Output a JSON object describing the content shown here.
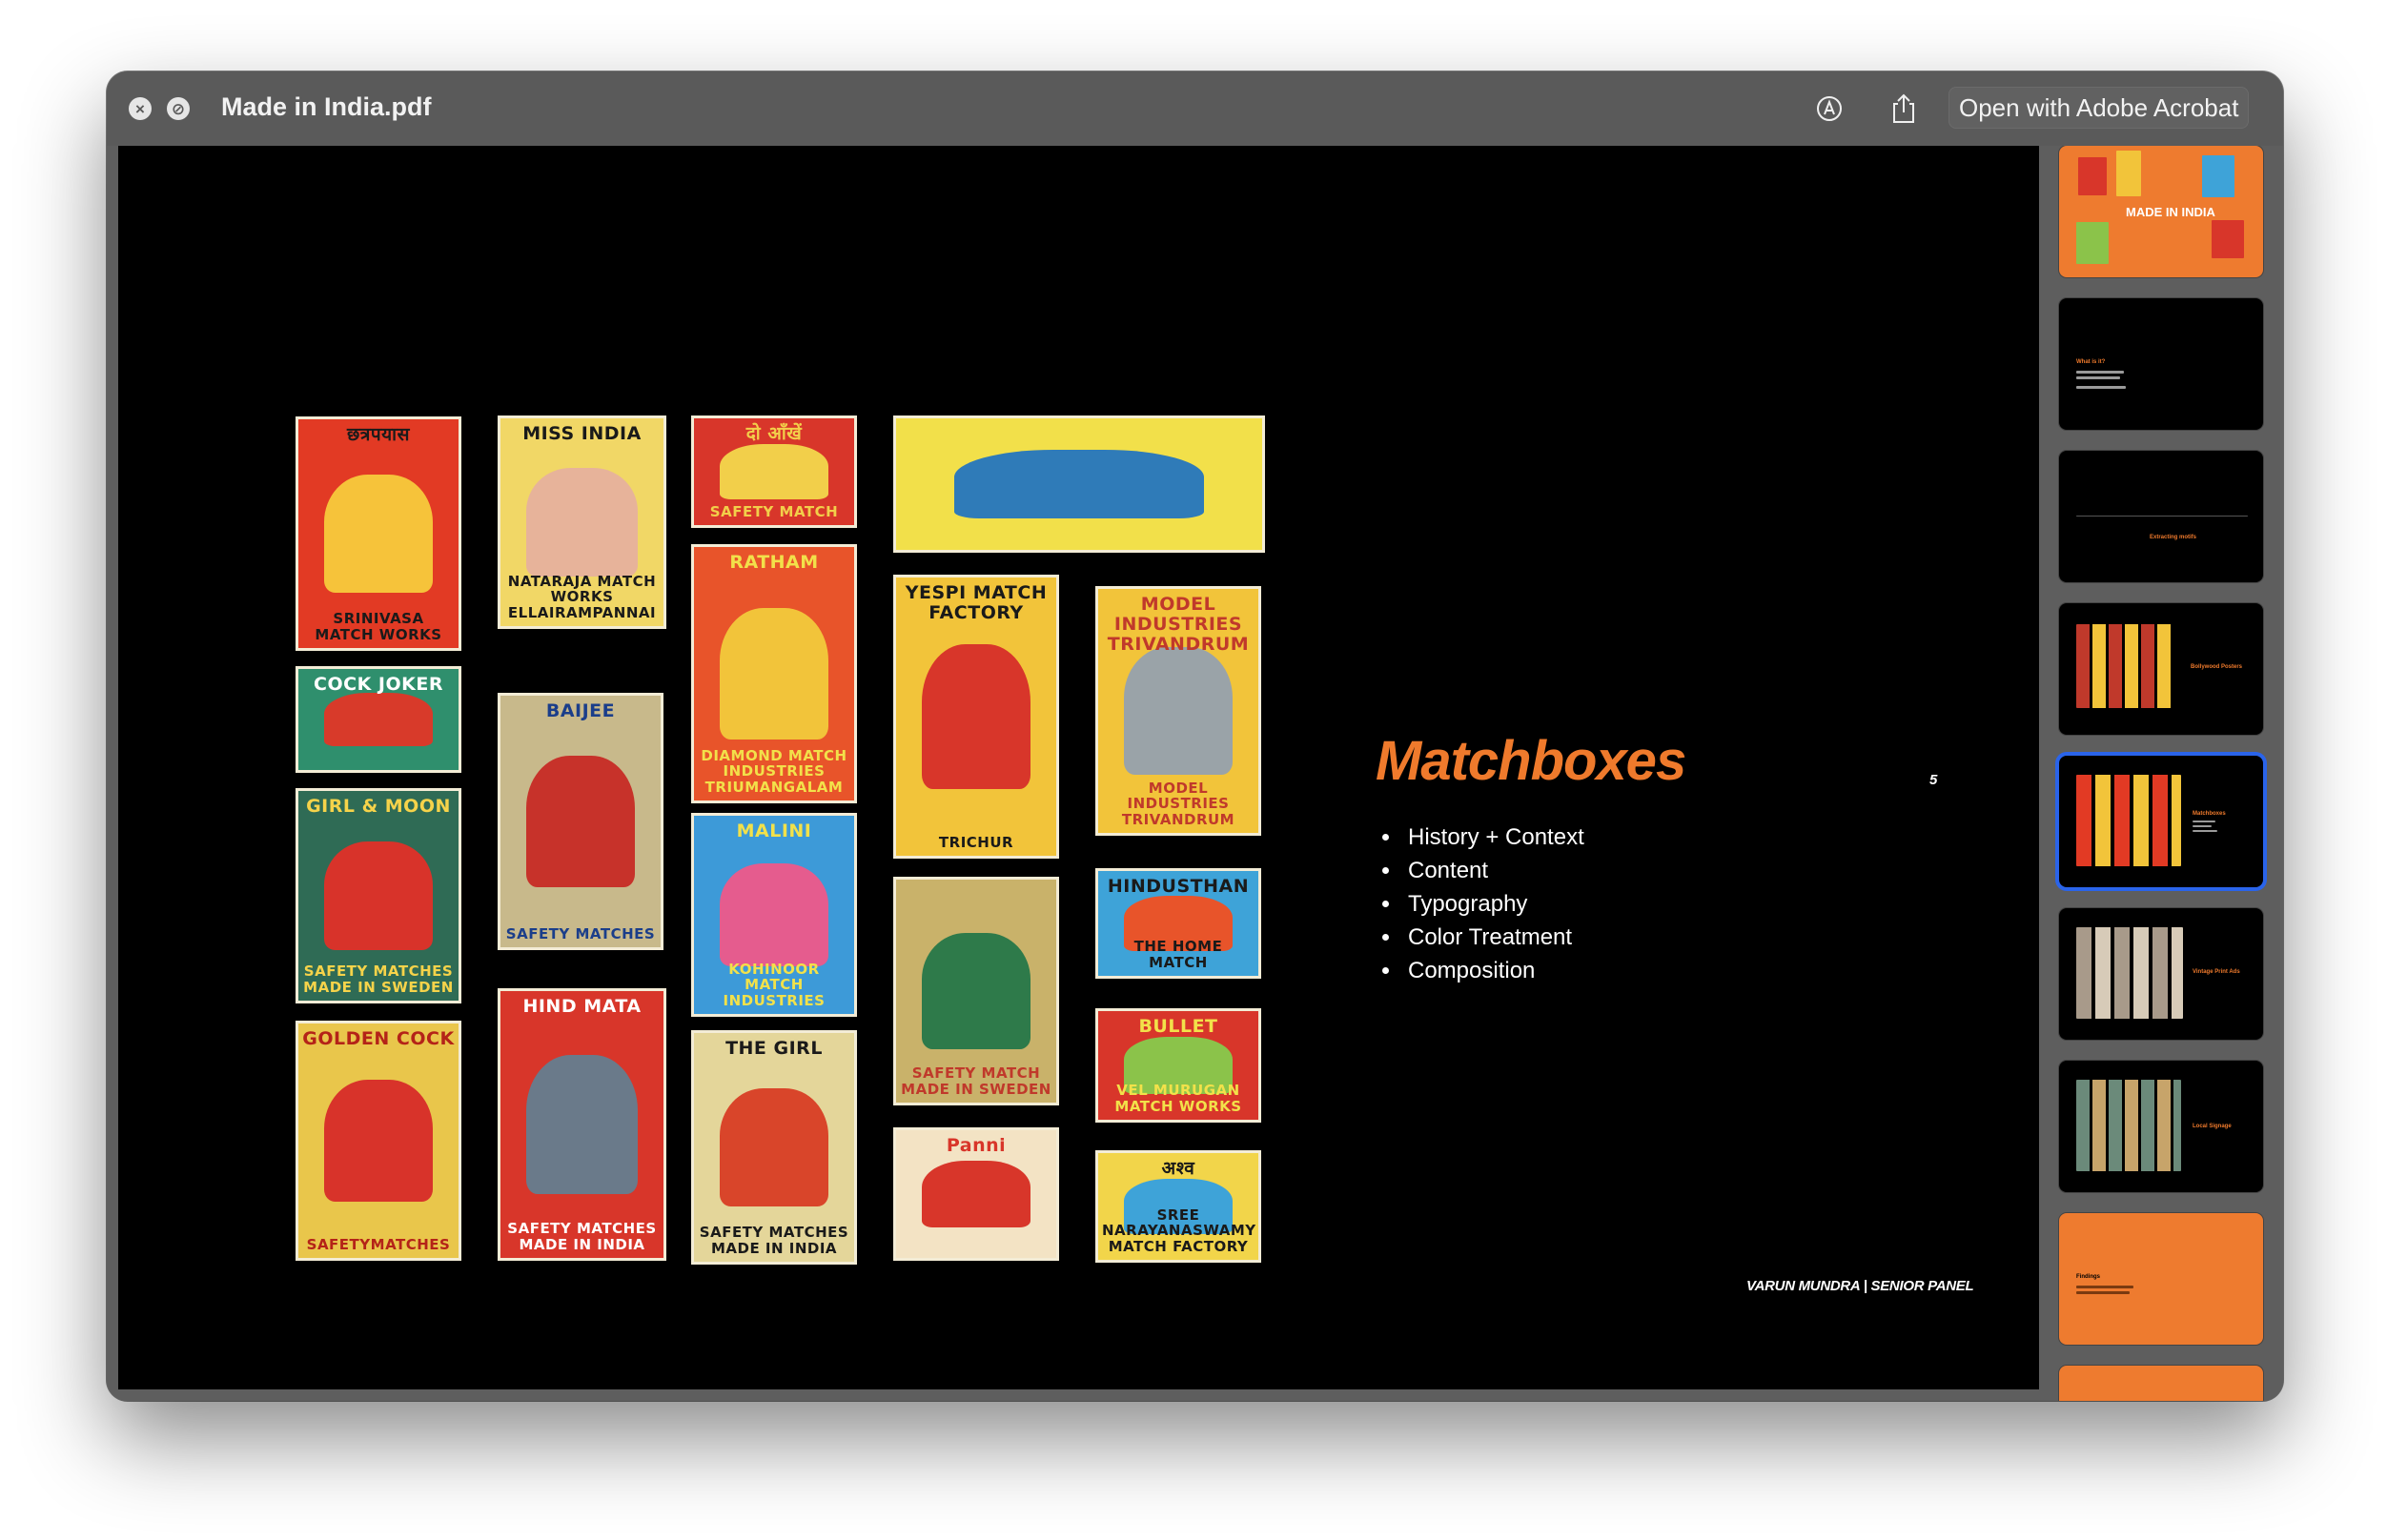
{
  "window": {
    "title": "Made in India.pdf",
    "open_button": "Open with Adobe Acrobat",
    "close_glyph": "×",
    "min_glyph": "⊘"
  },
  "slide": {
    "title": "Matchboxes",
    "page_number": "5",
    "bullets": [
      "History + Context",
      "Content",
      "Typography",
      "Color Treatment",
      "Composition"
    ],
    "footer": "VARUN MUNDRA | SENIOR PANEL",
    "matchboxes": [
      {
        "top": "छत्रपयास",
        "bottom": "SRINIVASA MATCH WORKS",
        "bg": "#e23a24",
        "art": "#f6c33a",
        "fg": "#1a1a1a"
      },
      {
        "top": "COCK JOKER",
        "bottom": "",
        "bg": "#2f8f6d",
        "art": "#d83a2a",
        "fg": "#ffffff"
      },
      {
        "top": "GIRL & MOON",
        "bottom": "SAFETY MATCHES MADE IN SWEDEN",
        "bg": "#2f6b55",
        "art": "#d8332a",
        "fg": "#f6d34a"
      },
      {
        "top": "GOLDEN COCK",
        "bottom": "SAFETYMATCHES",
        "bg": "#e9c64b",
        "art": "#d8332a",
        "fg": "#b42318"
      },
      {
        "top": "MISS INDIA",
        "bottom": "NATARAJA MATCH WORKS ELLAIRAMPANNAI",
        "bg": "#f1d766",
        "art": "#e7b39a",
        "fg": "#1a1a1a"
      },
      {
        "top": "BAIJEE",
        "bottom": "SAFETY MATCHES",
        "bg": "#c8b98b",
        "art": "#c7322a",
        "fg": "#1b3e8a"
      },
      {
        "top": "HIND MATA",
        "bottom": "SAFETY MATCHES MADE IN INDIA",
        "bg": "#d8362a",
        "art": "#6a7a8a",
        "fg": "#ffffff"
      },
      {
        "top": "दो आँखें",
        "bottom": "SAFETY MATCH",
        "bg": "#d8362a",
        "art": "#f2cf4a",
        "fg": "#f2cf4a"
      },
      {
        "top": "RATHAM",
        "bottom": "DIAMOND MATCH INDUSTRIES TRIUMANGALAM",
        "bg": "#e8542a",
        "art": "#f2c43a",
        "fg": "#f2e14a"
      },
      {
        "top": "MALINI",
        "bottom": "KOHINOOR MATCH INDUSTRIES",
        "bg": "#3d9ad8",
        "art": "#e55c8e",
        "fg": "#f2e14a"
      },
      {
        "top": "THE GIRL",
        "bottom": "SAFETY MATCHES MADE IN INDIA",
        "bg": "#e4d69a",
        "art": "#d9452a",
        "fg": "#1a1a1a"
      },
      {
        "top": "",
        "bottom": "",
        "bg": "#f2e04a",
        "art": "#2f7bb8",
        "fg": "#1a1a1a"
      },
      {
        "top": "YESPI MATCH FACTORY",
        "bottom": "TRICHUR",
        "bg": "#f2c43a",
        "art": "#d8362a",
        "fg": "#1a1a1a"
      },
      {
        "top": "",
        "bottom": "SAFETY MATCH MADE IN SWEDEN",
        "bg": "#c9b26a",
        "art": "#2e7a4a",
        "fg": "#c0392b"
      },
      {
        "top": "Panni",
        "bottom": "",
        "bg": "#f3e3c4",
        "art": "#d8362a",
        "fg": "#d8362a"
      },
      {
        "top": "MODEL INDUSTRIES TRIVANDRUM",
        "bottom": "MODEL INDUSTRIES TRIVANDRUM",
        "bg": "#f2c43a",
        "art": "#9aa3a8",
        "fg": "#c0392b"
      },
      {
        "top": "HINDUSTHAN",
        "bottom": "THE HOME MATCH",
        "bg": "#3ea3d8",
        "art": "#e8542a",
        "fg": "#1a1a1a"
      },
      {
        "top": "BULLET",
        "bottom": "VEL MURUGAN MATCH WORKS",
        "bg": "#d8362a",
        "art": "#8bc34a",
        "fg": "#f2e14a"
      },
      {
        "top": "अश्व",
        "bottom": "SREE NARAYANASWAMY MATCH FACTORY",
        "bg": "#f2d54a",
        "art": "#3ea3d8",
        "fg": "#1a1a1a"
      }
    ]
  },
  "thumbnails": [
    {
      "label": "MADE IN INDIA"
    },
    {
      "label": "What is it?"
    },
    {
      "label": "Extracting motifs"
    },
    {
      "label": "Bollywood Posters"
    },
    {
      "label": "Matchboxes"
    },
    {
      "label": "Vintage Print Ads"
    },
    {
      "label": "Local Signage"
    },
    {
      "label": "Findings"
    }
  ],
  "colors": {
    "accent": "#ef7a2c",
    "selection": "#2a64ea"
  }
}
